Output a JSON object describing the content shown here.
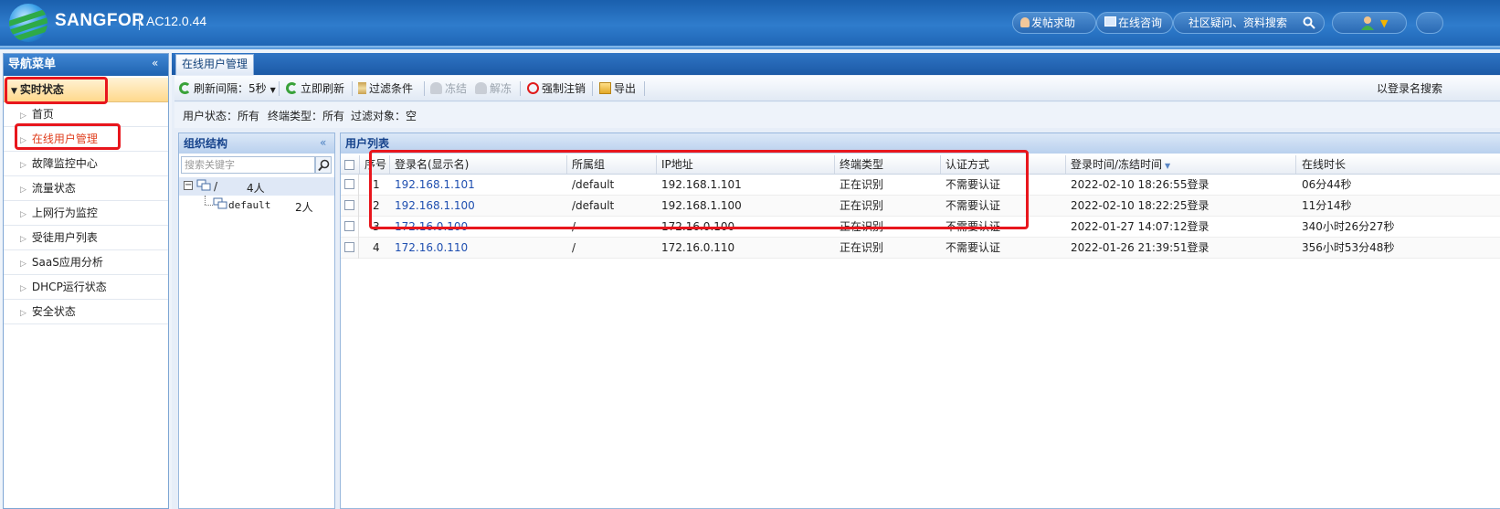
{
  "header": {
    "brand": "SANGFOR",
    "version": "AC12.0.44",
    "help_label": "发帖求助",
    "consult_label": "在线咨询",
    "search_placeholder": "社区疑问、资料搜索"
  },
  "sidebar": {
    "title": "导航菜单",
    "group_label": "实时状态",
    "items": [
      {
        "label": "首页"
      },
      {
        "label": "在线用户管理"
      },
      {
        "label": "故障监控中心"
      },
      {
        "label": "流量状态"
      },
      {
        "label": "上网行为监控"
      },
      {
        "label": "受徒用户列表"
      },
      {
        "label": "SaaS应用分析"
      },
      {
        "label": "DHCP运行状态"
      },
      {
        "label": "安全状态"
      }
    ]
  },
  "tabs": {
    "active_label": "在线用户管理"
  },
  "toolbar": {
    "refresh_interval": "刷新间隔：5秒",
    "refresh_now": "立即刷新",
    "filter": "过滤条件",
    "freeze": "冻结",
    "unfreeze": "解冻",
    "force_logout": "强制注销",
    "export": "导出",
    "search_label": "以登录名搜索"
  },
  "filters": {
    "user_status_label": "用户状态：",
    "user_status_value": "所有",
    "terminal_type_label": "终端类型：",
    "terminal_type_value": "所有",
    "filter_object_label": "过滤对象：",
    "filter_object_value": "空"
  },
  "org": {
    "title": "组织结构",
    "search_placeholder": "搜索关键字",
    "root": {
      "name": "/",
      "count": "4人"
    },
    "child": {
      "name": "default",
      "count": "2人"
    }
  },
  "user_list": {
    "title": "用户列表",
    "columns": [
      "序号",
      "登录名(显示名)",
      "所属组",
      "IP地址",
      "终端类型",
      "认证方式",
      "登录时间/冻结时间",
      "在线时长"
    ],
    "rows": [
      {
        "no": "1",
        "login": "192.168.1.101",
        "group": "/default",
        "ip": "192.168.1.101",
        "terminal": "正在识别",
        "auth": "不需要认证",
        "time": "2022-02-10 18:26:55登录",
        "duration": "06分44秒"
      },
      {
        "no": "2",
        "login": "192.168.1.100",
        "group": "/default",
        "ip": "192.168.1.100",
        "terminal": "正在识别",
        "auth": "不需要认证",
        "time": "2022-02-10 18:22:25登录",
        "duration": "11分14秒"
      },
      {
        "no": "3",
        "login": "172.16.0.100",
        "group": "/",
        "ip": "172.16.0.100",
        "terminal": "正在识别",
        "auth": "不需要认证",
        "time": "2022-01-27 14:07:12登录",
        "duration": "340小时26分27秒"
      },
      {
        "no": "4",
        "login": "172.16.0.110",
        "group": "/",
        "ip": "172.16.0.110",
        "terminal": "正在识别",
        "auth": "不需要认证",
        "time": "2022-01-26 21:39:51登录",
        "duration": "356小时53分48秒"
      }
    ]
  }
}
